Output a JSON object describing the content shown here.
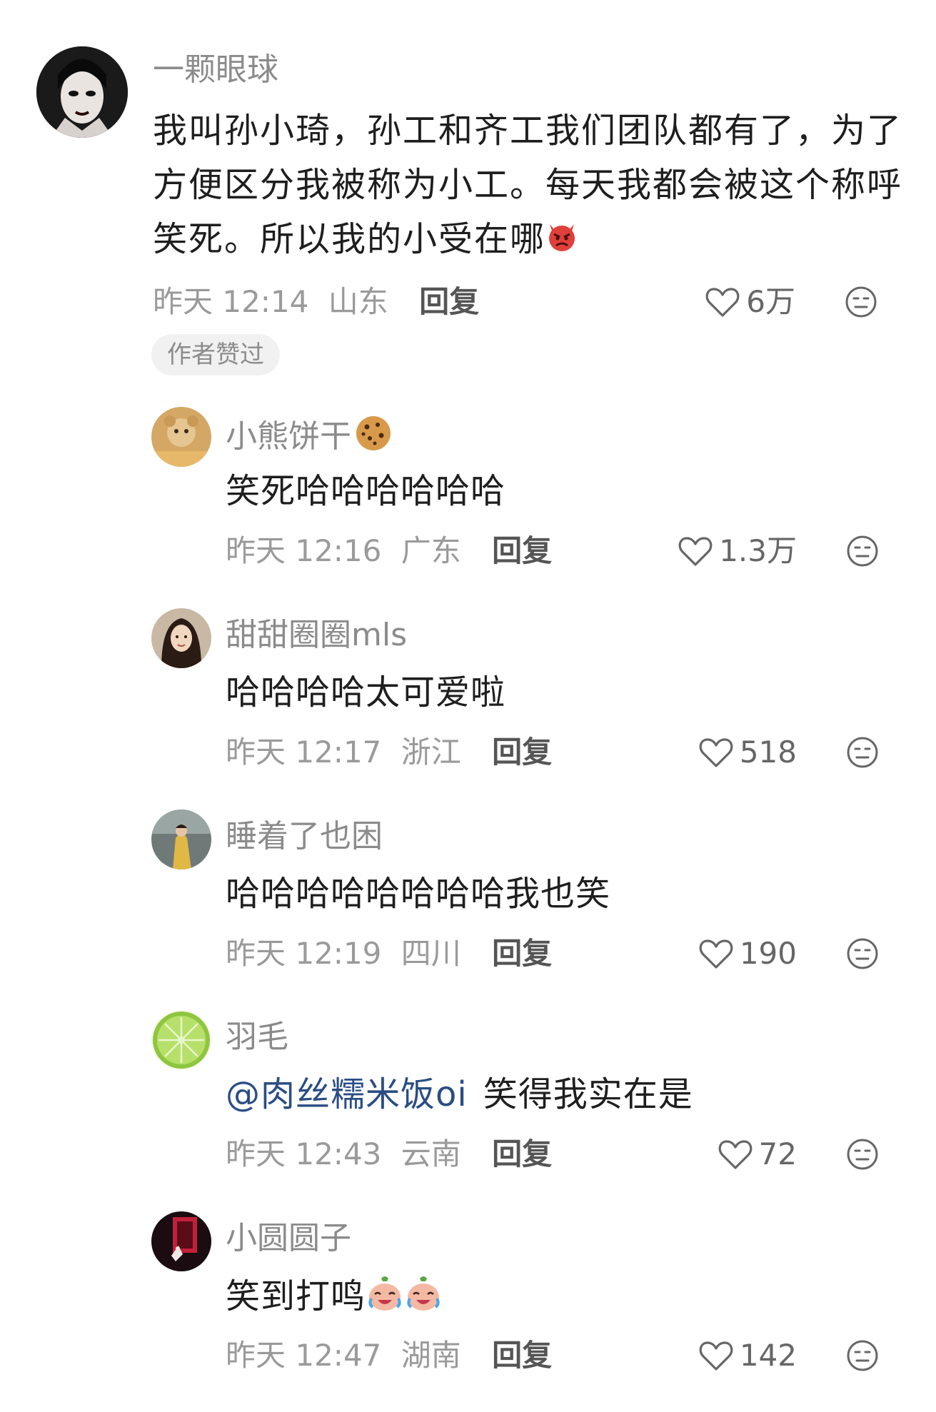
{
  "main_comment": {
    "username": "一颗眼球",
    "text": "我叫孙小琦，孙工和齐工我们团队都有了，为了方便区分我被称为小工。每天我都会被这个称呼笑死。所以我的小受在哪",
    "text_emoji": "angry-devil-emoji",
    "time": "昨天 12:14",
    "location": "山东",
    "reply_label": "回复",
    "likes": "6万",
    "badge": "作者赞过"
  },
  "replies": [
    {
      "username": "小熊饼干",
      "name_emoji": "cookie-emoji",
      "text": "笑死哈哈哈哈哈哈",
      "time": "昨天 12:16",
      "location": "广东",
      "reply_label": "回复",
      "likes": "1.3万"
    },
    {
      "username": "甜甜圈圈mls",
      "text": "哈哈哈哈太可爱啦",
      "time": "昨天 12:17",
      "location": "浙江",
      "reply_label": "回复",
      "likes": "518"
    },
    {
      "username": "睡着了也困",
      "text": "哈哈哈哈哈哈哈哈我也笑",
      "time": "昨天 12:19",
      "location": "四川",
      "reply_label": "回复",
      "likes": "190"
    },
    {
      "username": "羽毛",
      "mention": "@肉丝糯米饭oi",
      "text": "笑得我实在是",
      "time": "昨天 12:43",
      "location": "云南",
      "reply_label": "回复",
      "likes": "72"
    },
    {
      "username": "小圆圆子",
      "text": "笑到打鸣",
      "text_emoji": "crying-laughing-emoji",
      "time": "昨天 12:47",
      "location": "湖南",
      "reply_label": "回复",
      "likes": "142"
    }
  ],
  "colors": {
    "username": "#8b8b8b",
    "body_text": "#1e1e1e",
    "meta": "#9a9a9a",
    "mention": "#2a4d85",
    "badge_bg": "#f1f1f1"
  }
}
